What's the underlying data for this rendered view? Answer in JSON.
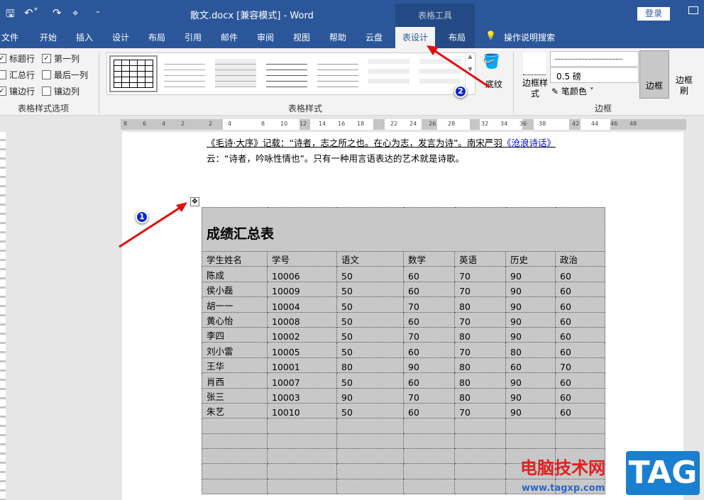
{
  "titlebar": {
    "title": "散文.docx [兼容模式]  -  Word",
    "context": "表格工具",
    "login": "登录"
  },
  "tabs": [
    "文件",
    "开始",
    "插入",
    "设计",
    "布局",
    "引用",
    "邮件",
    "审阅",
    "视图",
    "帮助",
    "云盘",
    "表设计",
    "布局"
  ],
  "tell_me": "操作说明搜索",
  "options": {
    "header_row": "标题行",
    "first_col": "第一列",
    "total_row": "汇总行",
    "last_col": "最后一列",
    "banded_rows": "镶边行",
    "banded_cols": "镶边列",
    "group": "表格样式选项"
  },
  "styles_group": "表格样式",
  "shading": "底纹",
  "borders": {
    "style_label": "边框样式",
    "weight": "0.5 磅",
    "pen_color": "笔颜色",
    "borders": "边框",
    "painter": "边框刷",
    "group": "边框"
  },
  "ruler": [
    "8",
    "6",
    "4",
    "2",
    "2",
    "4",
    "8",
    "10",
    "12",
    "14",
    "16",
    "18",
    "22",
    "24",
    "26",
    "28",
    "32",
    "34",
    "36",
    "38",
    "42",
    "44",
    "46",
    "48"
  ],
  "doc": {
    "line1a": "《毛诗·大序》记载：“诗者，志之所之也。在心为志，发言为诗”。南宋严羽",
    "line1link": "《沧浪诗话》",
    "line2": "云：“诗者，吟咏性情也”。只有一种用言语表达的艺术就是诗歌。"
  },
  "table": {
    "title": "成绩汇总表",
    "headers": [
      "学生姓名",
      "学号",
      "语文",
      "数学",
      "英语",
      "历史",
      "政治"
    ],
    "rows": [
      [
        "陈成",
        "10006",
        "50",
        "60",
        "70",
        "90",
        "60"
      ],
      [
        "侯小磊",
        "10009",
        "50",
        "60",
        "70",
        "90",
        "60"
      ],
      [
        "胡一一",
        "10004",
        "50",
        "70",
        "80",
        "90",
        "60"
      ],
      [
        "黄心怡",
        "10008",
        "50",
        "60",
        "70",
        "90",
        "60"
      ],
      [
        "李四",
        "10002",
        "50",
        "70",
        "80",
        "90",
        "60"
      ],
      [
        "刘小雷",
        "10005",
        "50",
        "60",
        "70",
        "80",
        "60"
      ],
      [
        "王华",
        "10001",
        "80",
        "90",
        "80",
        "60",
        "70"
      ],
      [
        "肖西",
        "10007",
        "50",
        "60",
        "80",
        "90",
        "60"
      ],
      [
        "张三",
        "10003",
        "90",
        "70",
        "80",
        "90",
        "60"
      ],
      [
        "朱艺",
        "10010",
        "50",
        "60",
        "70",
        "90",
        "60"
      ]
    ],
    "empty_rows": 5
  },
  "annotations": [
    "1",
    "2"
  ],
  "watermark": {
    "text": "电脑技术网",
    "url": "www.tagxp.com",
    "tag": "TAG"
  }
}
